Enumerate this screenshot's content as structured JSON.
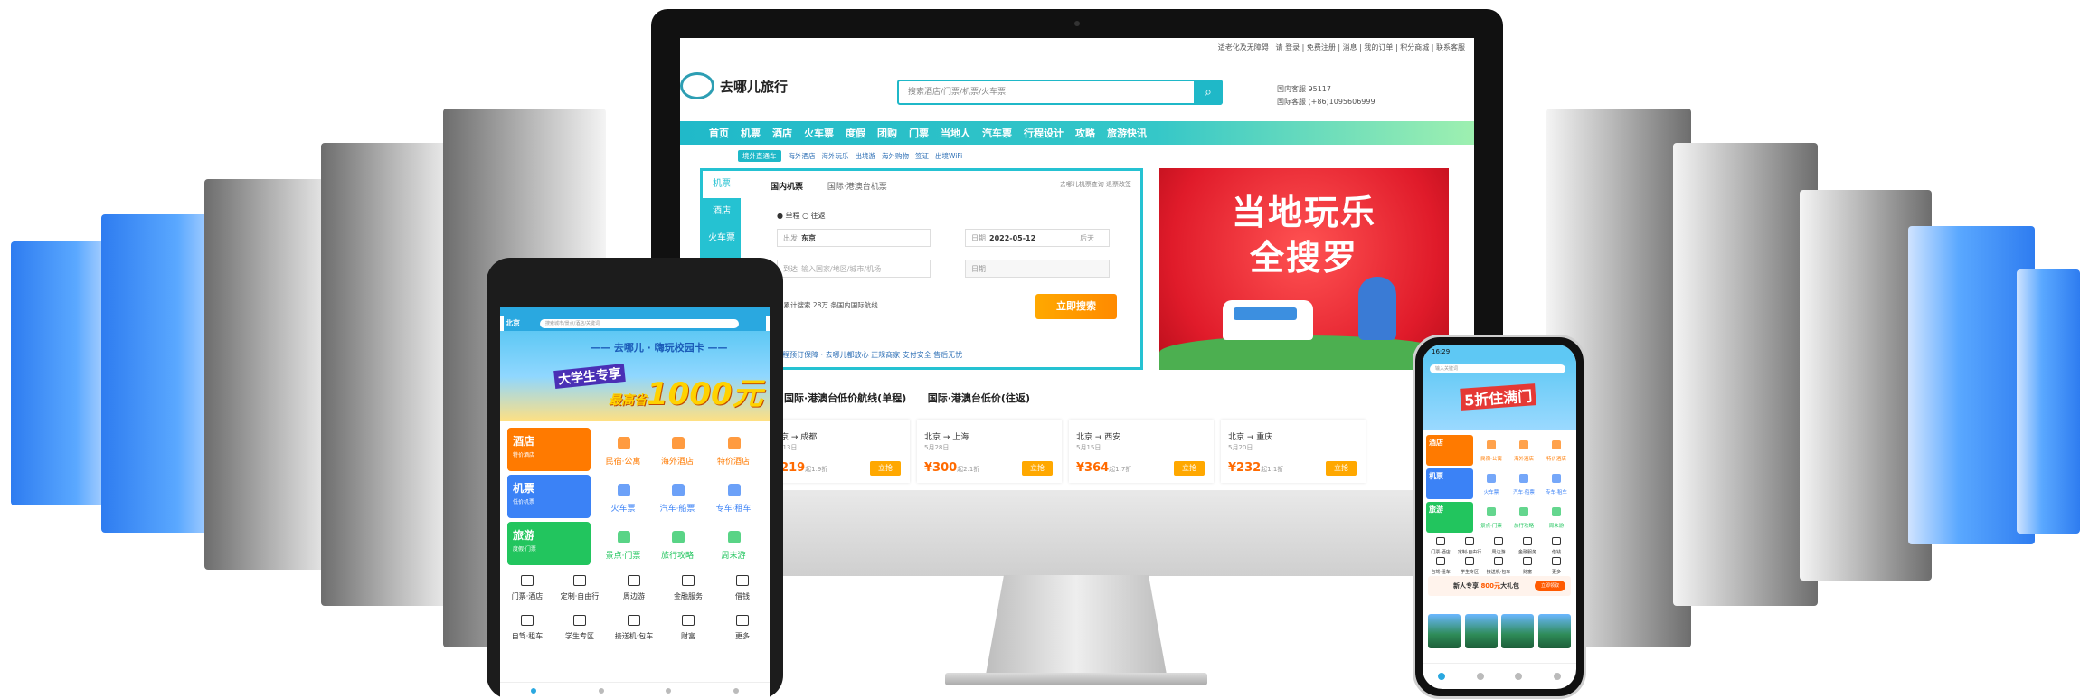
{
  "desktop": {
    "topbar": "适老化及无障碍 | 请 登录 | 免费注册 | 消息 | 我的订单 | 积分商城 | 联系客服",
    "logo_text": "去哪儿旅行",
    "search_placeholder": "搜索酒店/门票/机票/火车票",
    "hotline_line1": "国内客服 95117",
    "hotline_line2": "国际客服 (+86)1095606999",
    "nav": [
      "首页",
      "机票",
      "酒店",
      "火车票",
      "度假",
      "团购",
      "门票",
      "当地人",
      "汽车票",
      "行程设计",
      "攻略",
      "旅游快讯"
    ],
    "subnav_tag": "境外直通车",
    "subnav": [
      "海外酒店",
      "海外玩乐",
      "出境游",
      "海外购物",
      "签证",
      "出境WiFi"
    ],
    "side": [
      "机票",
      "酒店",
      "火车票"
    ],
    "tabs": [
      "国内机票",
      "国际·港澳台机票"
    ],
    "tabs_right": "去哪儿机票查询   退票改签",
    "radio": "● 单程   ○ 往返",
    "from_label": "出发",
    "from_value": "东京",
    "to_label": "到达",
    "to_placeholder": "输入国家/地区/城市/机场",
    "date_label": "日期",
    "date_value": "2022-05-12",
    "date_extra": "后天",
    "return_label": "日期",
    "search_button": "立即搜索",
    "stat": "已累计搜索 28万 条国内国际航线",
    "guarantee": "全程预订保障 · 去哪儿都放心   正规商家   支付安全   售后无忧",
    "banner_line1": "当地玩乐",
    "banner_line2": "全搜罗",
    "routes_tabs": [
      "国际·港澳台低价航线(单程)",
      "国际·港澳台低价(往返)"
    ],
    "routes": [
      {
        "route": "北京 → 成都",
        "date": "5月13日",
        "price": "¥219",
        "extra": "起1.9折",
        "btn": "立抢"
      },
      {
        "route": "北京 → 上海",
        "date": "5月28日",
        "price": "¥300",
        "extra": "起2.1折",
        "btn": "立抢"
      },
      {
        "route": "北京 → 西安",
        "date": "5月15日",
        "price": "¥364",
        "extra": "起1.7折",
        "btn": "立抢"
      },
      {
        "route": "北京 → 重庆",
        "date": "5月20日",
        "price": "¥232",
        "extra": "起1.1折",
        "btn": "立抢"
      }
    ],
    "first_card_btn": "立抢"
  },
  "tablet": {
    "city": "北京",
    "search_placeholder": "搜索城市/景点/酒店/关键词",
    "banner_a": "—— 去哪儿 · 嗨玩校园卡 ——",
    "banner_b": "大学生专享",
    "banner_c": "1000元",
    "banner_prefix": "最高省",
    "rows": [
      {
        "cat": "酒店",
        "sub": "特价酒店",
        "color": "#ff7a00",
        "items": [
          "民宿·公寓",
          "海外酒店",
          "特价酒店"
        ]
      },
      {
        "cat": "机票",
        "sub": "低价机票",
        "color": "#3b82f6",
        "items": [
          "火车票",
          "汽车·船票",
          "专车·租车"
        ]
      },
      {
        "cat": "旅游",
        "sub": "度假·门票",
        "color": "#22c55e",
        "items": [
          "景点·门票",
          "旅行攻略",
          "周末游"
        ]
      }
    ],
    "small1": [
      "门票·酒店",
      "定制·自由行",
      "周边游",
      "金融服务",
      "借钱"
    ],
    "small2": [
      "自驾·租车",
      "学生专区",
      "接送机·包车",
      "财富",
      "更多"
    ]
  },
  "phone": {
    "time": "16:29",
    "search_placeholder": "输入关键词",
    "banner": "5折住满门",
    "rows": [
      {
        "cat": "酒店",
        "color": "#ff7a00",
        "items": [
          "民宿·公寓",
          "海外酒店",
          "特价酒店"
        ]
      },
      {
        "cat": "机票",
        "color": "#3b82f6",
        "items": [
          "火车票",
          "汽车·船票",
          "专车·租车"
        ]
      },
      {
        "cat": "旅游",
        "color": "#22c55e",
        "items": [
          "景点·门票",
          "旅行攻略",
          "周末游"
        ]
      }
    ],
    "small1": [
      "门票·酒店",
      "定制·自由行",
      "周边游",
      "金融服务",
      "借钱"
    ],
    "small2": [
      "自驾·租车",
      "学生专区",
      "接送机·包车",
      "财富",
      "更多"
    ],
    "promo_prefix": "新人专享",
    "promo_amount": "800元",
    "promo_suffix": "大礼包",
    "promo_btn": "立即领取",
    "photos": [
      "周边游",
      "海岛度假",
      "出境游",
      "古镇"
    ]
  }
}
